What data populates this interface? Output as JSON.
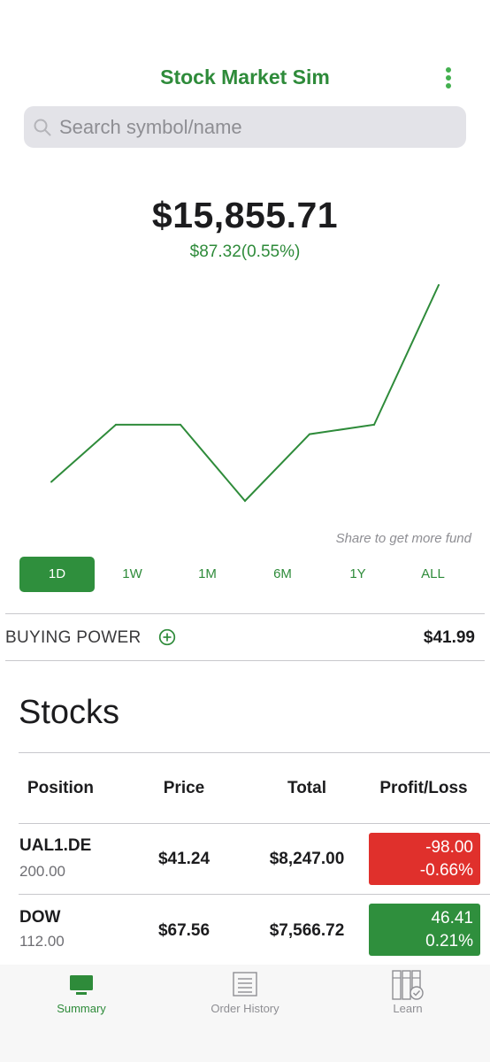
{
  "header": {
    "title": "Stock Market Sim",
    "menu_icon": "more-vertical-icon"
  },
  "search": {
    "placeholder": "Search symbol/name",
    "icon": "search-icon"
  },
  "portfolio": {
    "value": "$15,855.71",
    "change": "$87.32(0.55%)"
  },
  "chart_data": {
    "type": "line",
    "x": [
      0,
      1,
      2,
      3,
      4,
      5,
      6
    ],
    "y": [
      15794,
      15812,
      15812,
      15788,
      15809,
      15812,
      15856
    ],
    "color": "#2e8b3a",
    "grid": false,
    "xlabel": "",
    "ylabel": ""
  },
  "share_note": "Share to get more fund",
  "ranges": {
    "items": [
      "1D",
      "1W",
      "1M",
      "6M",
      "1Y",
      "ALL"
    ],
    "selected": "1D"
  },
  "buying_power": {
    "label": "BUYING POWER",
    "value": "$41.99",
    "add_icon": "plus-circle-icon"
  },
  "stocks": {
    "heading": "Stocks",
    "columns": [
      "Position",
      "Price",
      "Total",
      "Profit/Loss"
    ],
    "rows": [
      {
        "symbol": "UAL1.DE",
        "quantity": "200.00",
        "price": "$41.24",
        "total": "$8,247.00",
        "pl_value": "-98.00",
        "pl_percent": "-0.66%",
        "status": "loss"
      },
      {
        "symbol": "DOW",
        "quantity": "112.00",
        "price": "$67.56",
        "total": "$7,566.72",
        "pl_value": "46.41",
        "pl_percent": "0.21%",
        "status": "gain"
      }
    ]
  },
  "tabbar": {
    "items": [
      {
        "label": "Summary",
        "icon": "monitor-icon",
        "active": true
      },
      {
        "label": "Order History",
        "icon": "list-icon",
        "active": false
      },
      {
        "label": "Learn",
        "icon": "books-icon",
        "active": false
      }
    ]
  },
  "colors": {
    "accent": "#2e8b3a",
    "gain": "#2f8f3d",
    "loss": "#e0302c",
    "inactive": "#8e8e93"
  }
}
